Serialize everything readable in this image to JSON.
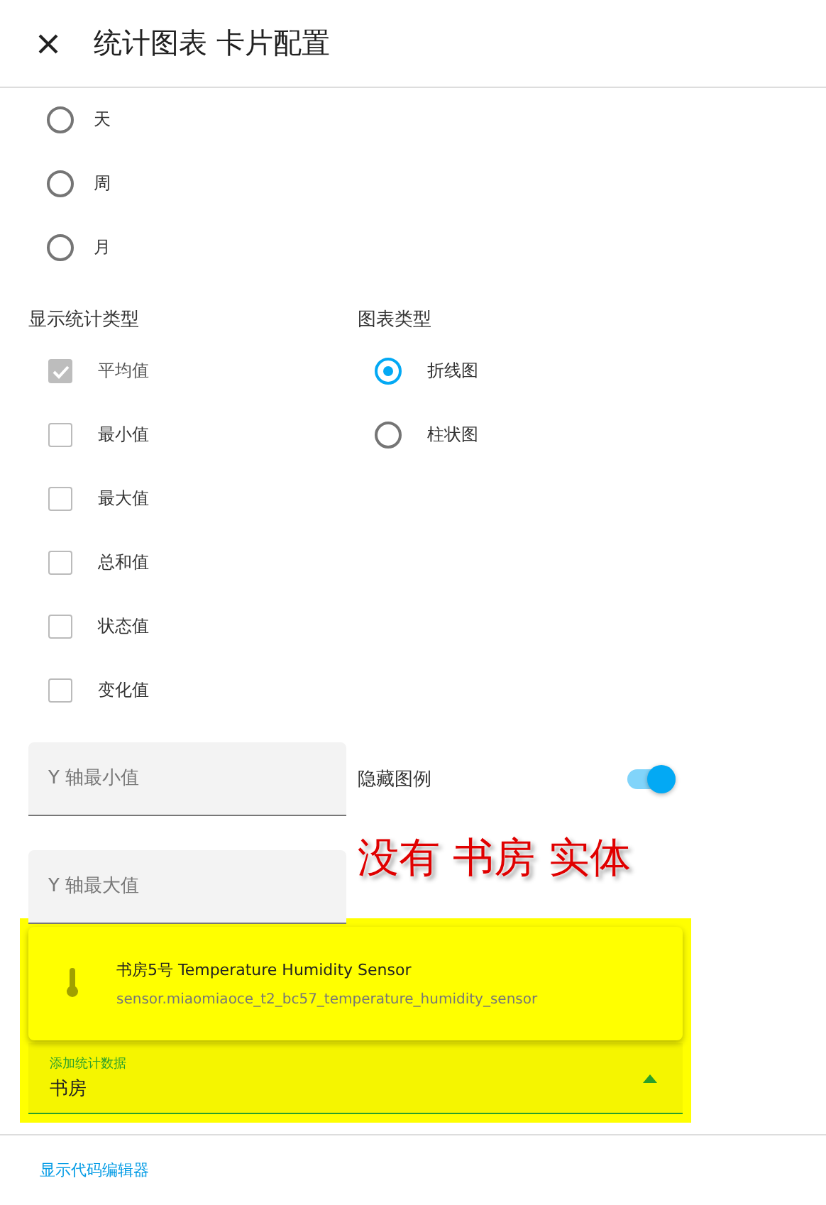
{
  "dialog": {
    "title": "统计图表 卡片配置"
  },
  "period_options": [
    {
      "label": "天",
      "selected": false
    },
    {
      "label": "周",
      "selected": false
    },
    {
      "label": "月",
      "selected": false
    }
  ],
  "stat_types": {
    "heading": "显示统计类型",
    "items": [
      {
        "label": "平均值",
        "checked": true,
        "disabled": true
      },
      {
        "label": "最小值",
        "checked": false,
        "disabled": false
      },
      {
        "label": "最大值",
        "checked": false,
        "disabled": false
      },
      {
        "label": "总和值",
        "checked": false,
        "disabled": false
      },
      {
        "label": "状态值",
        "checked": false,
        "disabled": false
      },
      {
        "label": "变化值",
        "checked": false,
        "disabled": false
      }
    ]
  },
  "chart_types": {
    "heading": "图表类型",
    "items": [
      {
        "label": "折线图",
        "selected": true
      },
      {
        "label": "柱状图",
        "selected": false
      }
    ]
  },
  "y_fields": [
    {
      "placeholder": "Y 轴最小值"
    },
    {
      "placeholder": "Y 轴最大值"
    }
  ],
  "hide_legend": {
    "label": "隐藏图例",
    "on": true
  },
  "annotation": {
    "text": "没有 书房 实体",
    "highlight": true
  },
  "suggestion": {
    "name": "书房5号 Temperature Humidity Sensor",
    "entity_id": "sensor.miaomiaoce_t2_bc57_temperature_humidity_sensor"
  },
  "add_statistic": {
    "label": "添加统计数据",
    "value": "书房",
    "expanded": true
  },
  "footer": {
    "link": "显示代码编辑器"
  }
}
